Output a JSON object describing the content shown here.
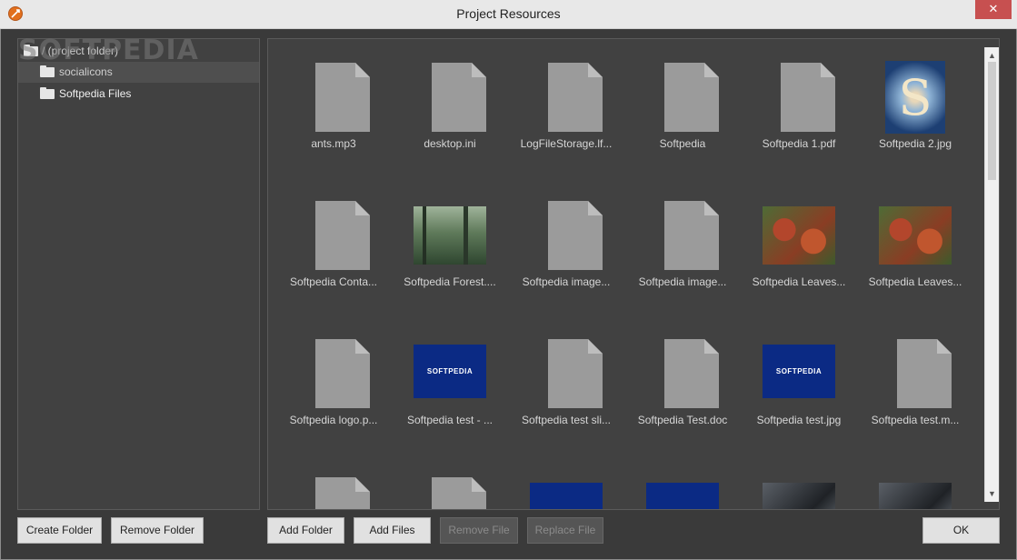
{
  "window": {
    "title": "Project Resources",
    "close_glyph": "✕",
    "watermark": "SOFTPEDIA"
  },
  "tree": [
    {
      "label": "/ (project folder)"
    },
    {
      "label": "socialicons"
    },
    {
      "label": "Softpedia Files"
    }
  ],
  "files": [
    {
      "name": "ants.mp3",
      "thumb": "doc"
    },
    {
      "name": "desktop.ini",
      "thumb": "doc"
    },
    {
      "name": "LogFileStorage.lf...",
      "thumb": "doc"
    },
    {
      "name": "Softpedia",
      "thumb": "doc"
    },
    {
      "name": "Softpedia 1.pdf",
      "thumb": "doc"
    },
    {
      "name": "Softpedia 2.jpg",
      "thumb": "s-image"
    },
    {
      "name": "Softpedia Conta...",
      "thumb": "doc"
    },
    {
      "name": "Softpedia Forest....",
      "thumb": "forest"
    },
    {
      "name": "Softpedia image...",
      "thumb": "doc"
    },
    {
      "name": "Softpedia image...",
      "thumb": "doc"
    },
    {
      "name": "Softpedia Leaves...",
      "thumb": "leaves"
    },
    {
      "name": "Softpedia Leaves...",
      "thumb": "leaves"
    },
    {
      "name": "Softpedia logo.p...",
      "thumb": "doc"
    },
    {
      "name": "Softpedia test - ...",
      "thumb": "logo"
    },
    {
      "name": "Softpedia test sli...",
      "thumb": "doc"
    },
    {
      "name": "Softpedia Test.doc",
      "thumb": "doc"
    },
    {
      "name": "Softpedia test.jpg",
      "thumb": "logo"
    },
    {
      "name": "Softpedia test.m...",
      "thumb": "doc"
    },
    {
      "name": "",
      "thumb": "doc"
    },
    {
      "name": "",
      "thumb": "doc"
    },
    {
      "name": "",
      "thumb": "blue"
    },
    {
      "name": "",
      "thumb": "blue"
    },
    {
      "name": "",
      "thumb": "dark"
    },
    {
      "name": "",
      "thumb": "dark"
    }
  ],
  "logo_text": "SOFTPEDIA",
  "buttons": {
    "create_folder": "Create Folder",
    "remove_folder": "Remove Folder",
    "add_folder": "Add Folder",
    "add_files": "Add Files",
    "remove_file": "Remove File",
    "replace_file": "Replace File",
    "ok": "OK"
  },
  "scroll": {
    "up": "▲",
    "down": "▼"
  },
  "colors": {
    "doc": "#9b9b9b",
    "logo_bg": "#0b2a84",
    "panel": "#414141"
  }
}
